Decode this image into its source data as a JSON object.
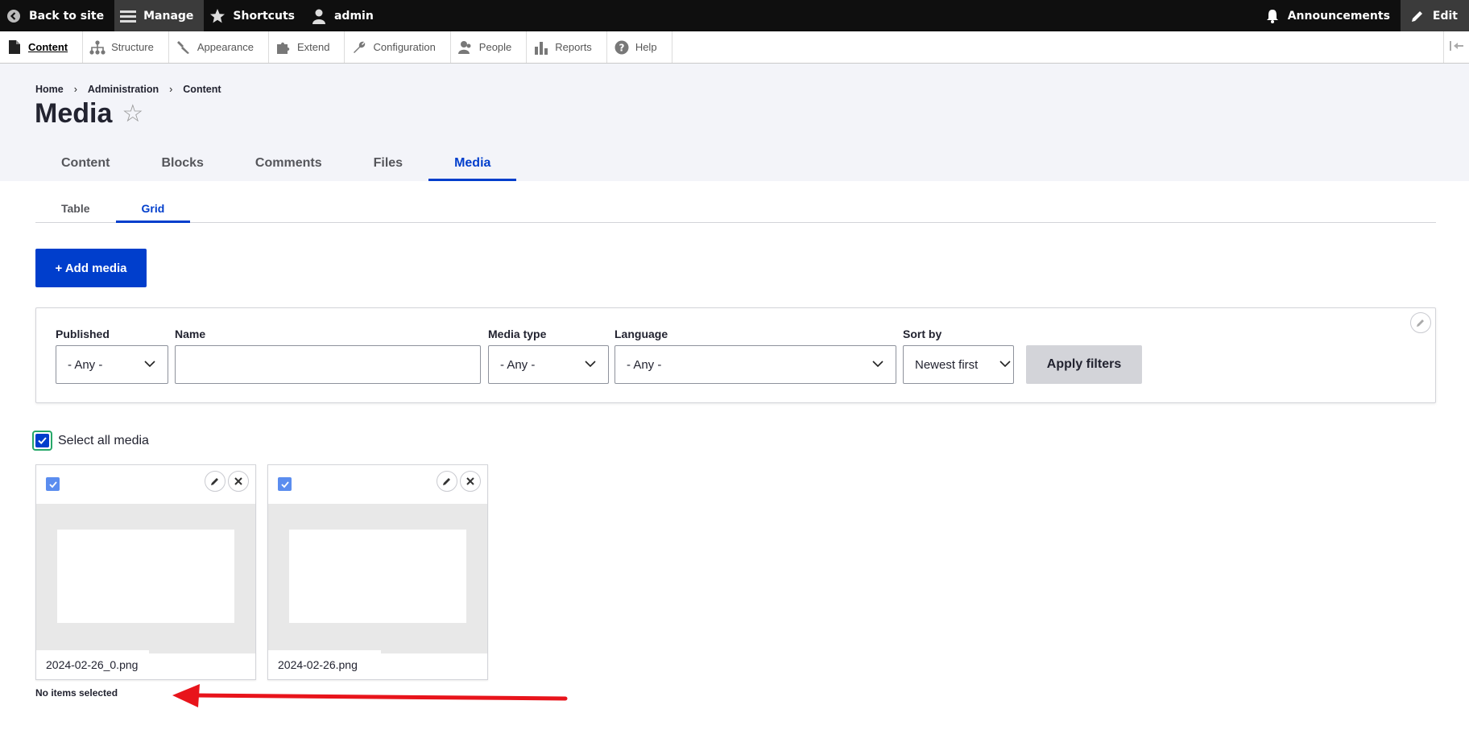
{
  "toolbar": {
    "back_to_site": "Back to site",
    "manage": "Manage",
    "shortcuts": "Shortcuts",
    "user": "admin",
    "announcements": "Announcements",
    "edit": "Edit"
  },
  "tray": {
    "items": [
      {
        "label": "Content",
        "icon": "file-icon",
        "active": true
      },
      {
        "label": "Structure",
        "icon": "sitemap-icon"
      },
      {
        "label": "Appearance",
        "icon": "paintbrush-icon"
      },
      {
        "label": "Extend",
        "icon": "puzzle-icon"
      },
      {
        "label": "Configuration",
        "icon": "wrench-icon"
      },
      {
        "label": "People",
        "icon": "people-icon"
      },
      {
        "label": "Reports",
        "icon": "bar-chart-icon"
      },
      {
        "label": "Help",
        "icon": "help-icon"
      }
    ]
  },
  "breadcrumb": [
    "Home",
    "Administration",
    "Content"
  ],
  "page": {
    "title": "Media",
    "star": "☆"
  },
  "primary_tabs": [
    "Content",
    "Blocks",
    "Comments",
    "Files",
    "Media"
  ],
  "primary_active": "Media",
  "secondary_tabs": [
    "Table",
    "Grid"
  ],
  "secondary_active": "Grid",
  "add_media": "+ Add media",
  "filters": {
    "published": {
      "label": "Published",
      "value": "- Any -"
    },
    "name": {
      "label": "Name",
      "value": ""
    },
    "media_type": {
      "label": "Media type",
      "value": "- Any -"
    },
    "language": {
      "label": "Language",
      "value": "- Any -"
    },
    "sort_by": {
      "label": "Sort by",
      "value": "Newest first"
    },
    "apply": "Apply filters"
  },
  "select_all": {
    "label": "Select all media",
    "checked": true
  },
  "media_items": [
    {
      "name": "2024-02-26_0.png",
      "checked": true
    },
    {
      "name": "2024-02-26.png",
      "checked": true
    }
  ],
  "status": "No items selected",
  "colors": {
    "accent": "#003ecc",
    "annotation_arrow": "#e8141b"
  }
}
